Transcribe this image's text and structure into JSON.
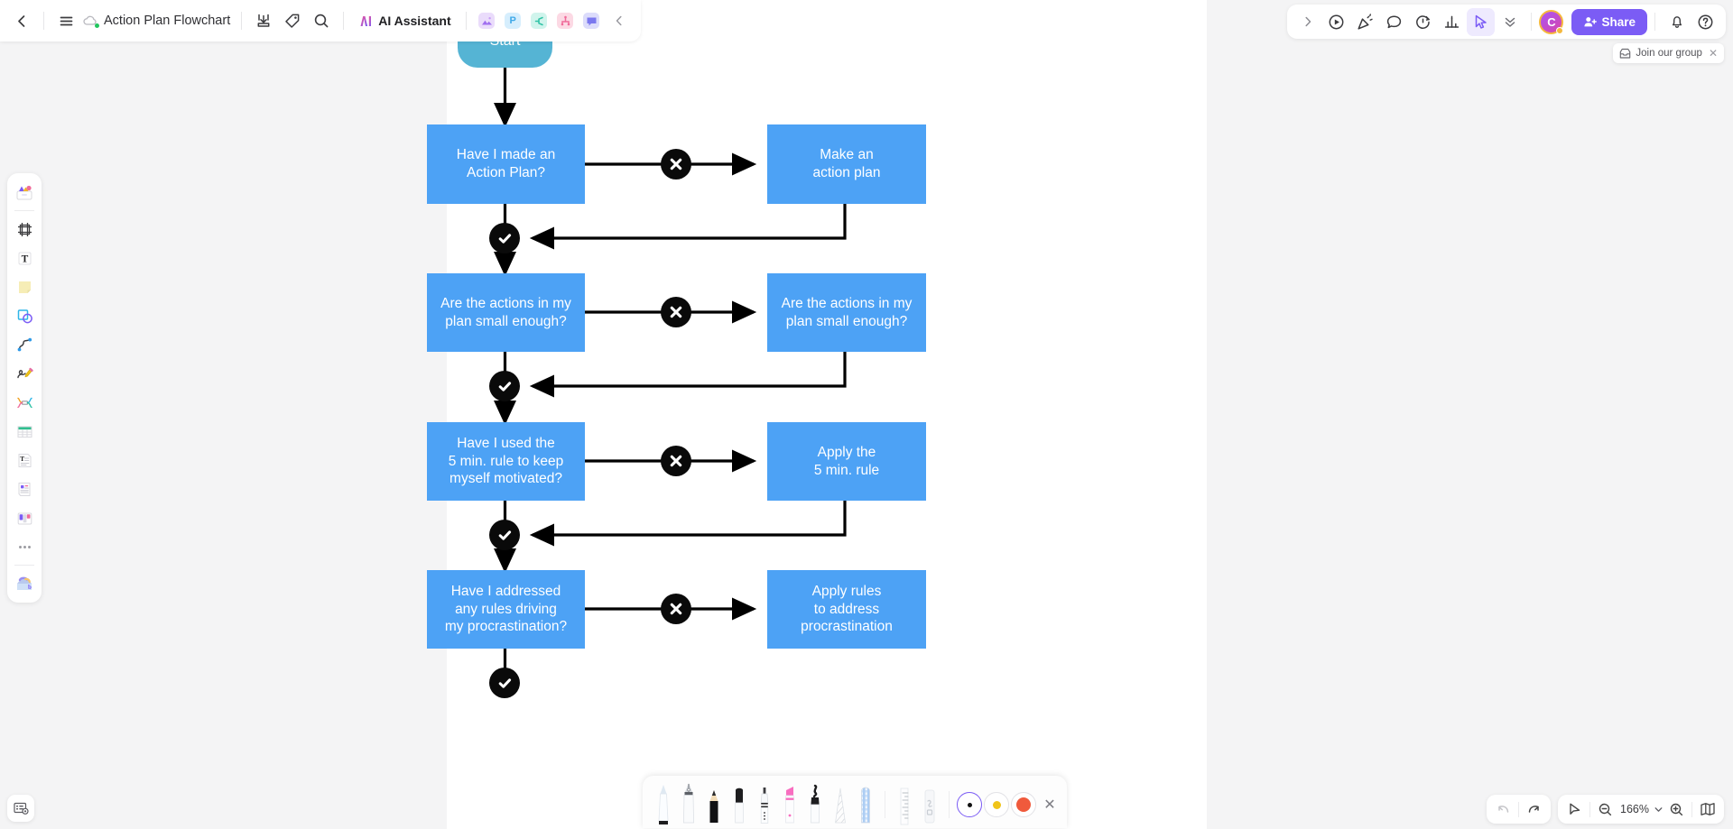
{
  "document": {
    "title": "Action Plan Flowchart",
    "zoom_level": "166%"
  },
  "top_left_toolbar": {
    "back_icon": "back-chevron-icon",
    "menu_icon": "hamburger-menu-icon",
    "cloud_icon": "cloud-saved-icon",
    "export_icon": "export-download-icon",
    "tag_icon": "tag-icon",
    "search_icon": "search-icon",
    "ai_assistant_label": "AI Assistant",
    "quick_icons": [
      {
        "name": "image-icon",
        "glyph": "⛰",
        "bg": "#e9dcfb",
        "fg": "#a06ef0"
      },
      {
        "name": "ppt-icon",
        "glyph": "P",
        "bg": "#d9f0fd",
        "fg": "#3fa9e8"
      },
      {
        "name": "mindmap-icon",
        "glyph": "≣",
        "bg": "#d4f5ef",
        "fg": "#2fc2a5"
      },
      {
        "name": "tree-diagram-icon",
        "glyph": "⑂",
        "bg": "#fcdce6",
        "fg": "#f06b9a"
      },
      {
        "name": "comment-icon",
        "glyph": "■",
        "bg": "#dcdcfb",
        "fg": "#7b78ef"
      }
    ],
    "collapse_icon": "collapse-chevron-icon"
  },
  "top_right_toolbar": {
    "expand_icon": "expand-chevron-icon",
    "present_icon": "play-present-icon",
    "celebrate_icon": "confetti-icon",
    "comment_icon": "comment-bubble-icon",
    "timer_icon": "timer-icon",
    "vote_icon": "vote-chart-icon",
    "cursor_icon": "cursor-pointer-icon",
    "more_icon": "chevron-double-down-icon",
    "avatar_initial": "C",
    "share_label": "Share",
    "share_icon": "share-person-icon",
    "bell_icon": "notification-bell-icon",
    "help_icon": "help-question-icon",
    "accent_color": "#7b5cf5"
  },
  "join_banner": {
    "icon": "inbox-icon",
    "label": "Join our group",
    "close_icon": "close-icon"
  },
  "left_toolbar": {
    "items": [
      {
        "name": "templates-icon",
        "label": "Templates"
      },
      {
        "name": "frame-icon",
        "label": "Frame"
      },
      {
        "name": "text-icon",
        "label": "Text"
      },
      {
        "name": "sticky-note-icon",
        "label": "Sticky Note"
      },
      {
        "name": "shapes-icon",
        "label": "Shapes"
      },
      {
        "name": "connector-icon",
        "label": "Connector"
      },
      {
        "name": "pen-icon",
        "label": "Pen"
      },
      {
        "name": "mindmap-node-icon",
        "label": "Mind Map"
      },
      {
        "name": "table-icon",
        "label": "Table"
      },
      {
        "name": "document-icon",
        "label": "Document"
      },
      {
        "name": "card-icon",
        "label": "Card"
      },
      {
        "name": "kanban-icon",
        "label": "Kanban"
      },
      {
        "name": "more-tools-icon",
        "label": "More"
      },
      {
        "name": "plugins-icon",
        "label": "Plugins"
      }
    ]
  },
  "bottom_left": {
    "icon": "presentation-settings-icon"
  },
  "bottom_right": {
    "undo_icon": "undo-icon",
    "redo_icon": "redo-icon",
    "select_icon": "cursor-select-icon",
    "zoom_out_icon": "zoom-out-icon",
    "zoom_value": "166%",
    "zoom_dropdown_icon": "chevron-down-icon",
    "zoom_in_icon": "zoom-in-icon",
    "minimap_icon": "minimap-icon"
  },
  "pen_toolbar": {
    "tools": [
      {
        "name": "ballpoint-pen-tool",
        "label": "Ballpoint Pen"
      },
      {
        "name": "fountain-pen-tool",
        "label": "Fountain Pen"
      },
      {
        "name": "pencil-tool",
        "label": "Pencil"
      },
      {
        "name": "brush-pen-tool",
        "label": "Brush Pen"
      },
      {
        "name": "marker-tool",
        "label": "Marker"
      },
      {
        "name": "highlighter-tool",
        "label": "Highlighter"
      },
      {
        "name": "paint-marker-tool",
        "label": "Paint Marker"
      },
      {
        "name": "texture-pen-tool",
        "label": "Texture Pen"
      },
      {
        "name": "pattern-pen-tool",
        "label": "Pattern Pen"
      },
      {
        "name": "ruler-tool",
        "label": "Ruler"
      },
      {
        "name": "eraser-tool",
        "label": "Eraser"
      }
    ],
    "swatches": [
      {
        "name": "swatch-black",
        "color": "#111111",
        "size": 6,
        "selected": true
      },
      {
        "name": "swatch-yellow",
        "color": "#f0c419",
        "size": 10,
        "selected": false
      },
      {
        "name": "swatch-red",
        "color": "#f05a3c",
        "size": 17,
        "selected": false
      }
    ],
    "close_icon": "close-icon"
  },
  "flowchart": {
    "colors": {
      "start_node": "#55b4d4",
      "decision_node": "#4da2f5",
      "marker": "#0a0a0a",
      "edge": "#000000"
    },
    "start_node": {
      "label": "Start"
    },
    "rows": [
      {
        "left": "Have I made an\nAction Plan?",
        "right": "Make an\naction plan",
        "no_marker": "no-marker-x",
        "yes_marker": "yes-marker-check"
      },
      {
        "left": "Are the actions in my\nplan small enough?",
        "right": "Are the actions in my\nplan small enough?",
        "no_marker": "no-marker-x",
        "yes_marker": "yes-marker-check"
      },
      {
        "left": "Have I used the\n5 min. rule to keep\nmyself motivated?",
        "right": "Apply the\n5 min. rule",
        "no_marker": "no-marker-x",
        "yes_marker": "yes-marker-check"
      },
      {
        "left": "Have I addressed\nany rules driving\nmy procrastination?",
        "right": "Apply rules\nto address\nprocrastination",
        "no_marker": "no-marker-x",
        "yes_marker": "yes-marker-check"
      }
    ]
  }
}
